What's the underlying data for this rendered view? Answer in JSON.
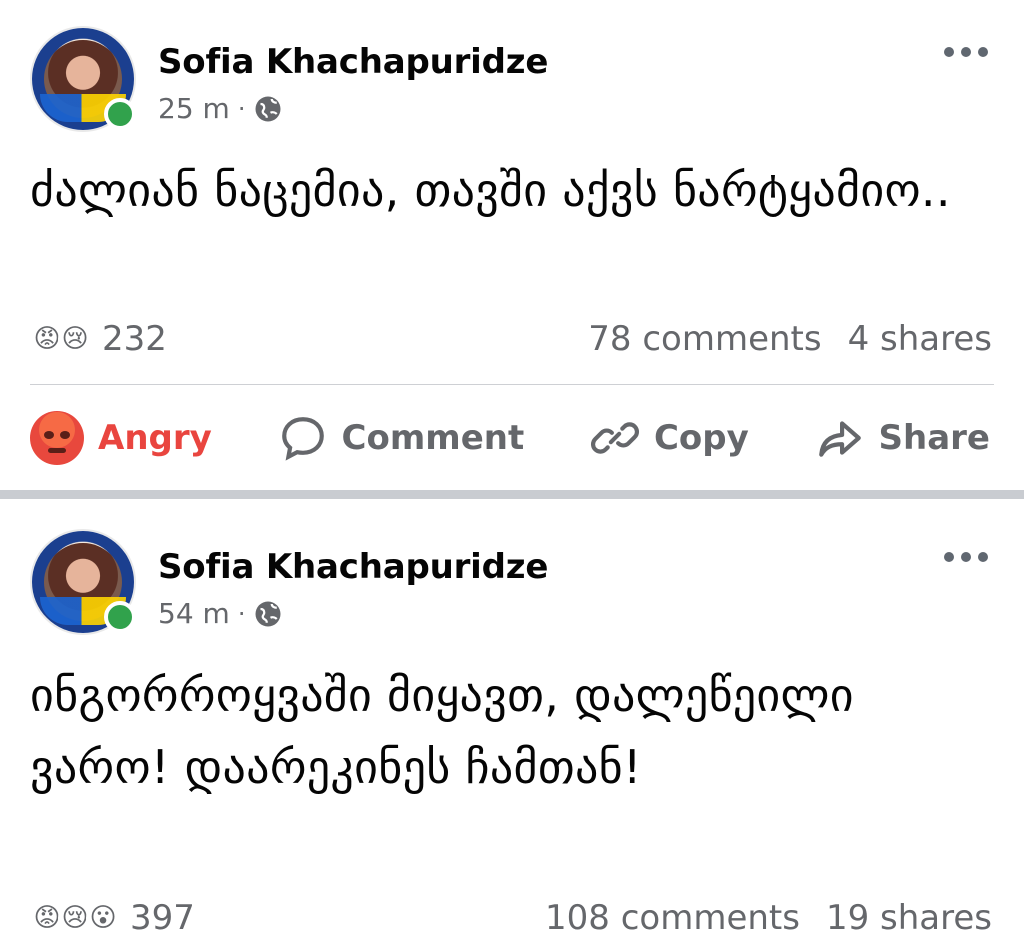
{
  "posts": [
    {
      "author": "Sofia Khachapuridze",
      "time": "25 m",
      "separator": "·",
      "text": "ძალიან ნაცემია, თავში აქვს ნარტყამიო..",
      "reactions": [
        "angry",
        "sad"
      ],
      "reaction_emojis": [
        "😡",
        "😢"
      ],
      "reaction_count": "232",
      "comments": "78 comments",
      "shares": "4 shares",
      "actions": {
        "react": "Angry",
        "comment": "Comment",
        "copy": "Copy",
        "share": "Share"
      }
    },
    {
      "author": "Sofia Khachapuridze",
      "time": "54 m",
      "separator": "·",
      "text": "ინგორროყვაში მიყავთ, დალეწეილი ვარო! დაარეკინეს ჩამთან!",
      "reactions": [
        "angry",
        "sad",
        "wow"
      ],
      "reaction_emojis": [
        "😡",
        "😢",
        "😮"
      ],
      "reaction_count": "397",
      "comments": "108 comments",
      "shares": "19 shares"
    }
  ],
  "colors": {
    "angry_accent": "#e9453f",
    "meta_gray": "#65676b",
    "online_green": "#31a24c",
    "separator": "#c9ccd1"
  },
  "icons": {
    "visibility": "globe-icon",
    "more": "more-options-icon",
    "comment": "speech-bubble-icon",
    "copy": "link-icon",
    "share": "share-arrow-icon"
  }
}
